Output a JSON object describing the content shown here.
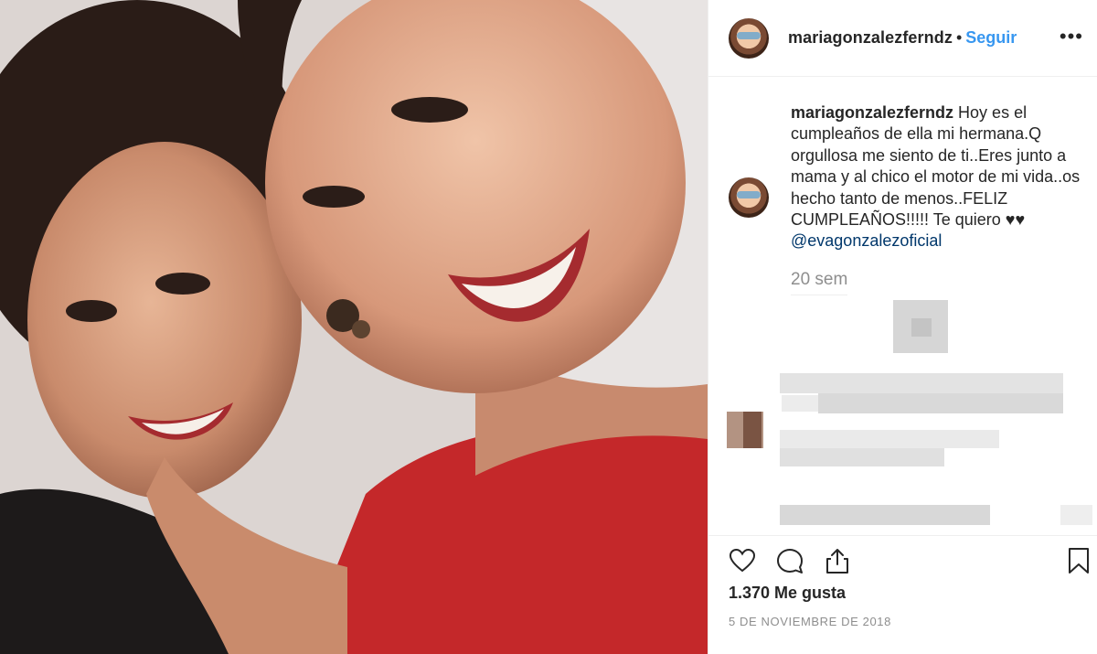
{
  "post": {
    "username": "mariagonzalezferndz",
    "separator": "•",
    "follow_label": "Seguir",
    "more_label": "•••",
    "caption_user": "mariagonzalezferndz",
    "caption_text": " Hoy es el cumpleaños de ella mi hermana.Q orgullosa me siento de ti..Eres junto a mama y al chico el motor de mi vida..os hecho tanto de menos..FELIZ CUMPLEAÑOS!!!!! Te quiero ♥♥",
    "mention": "@evagonzalezoficial",
    "time_ago": "20 sem",
    "likes": "1.370 Me gusta",
    "date": "5 DE NOVIEMBRE DE 2018"
  },
  "icons": {
    "like": "heart-icon",
    "comment": "comment-icon",
    "share": "share-icon",
    "save": "bookmark-icon",
    "more": "more-icon"
  },
  "colors": {
    "link": "#3897f0",
    "mention": "#00376b",
    "muted": "#8e8e8e",
    "border": "#efefef"
  }
}
